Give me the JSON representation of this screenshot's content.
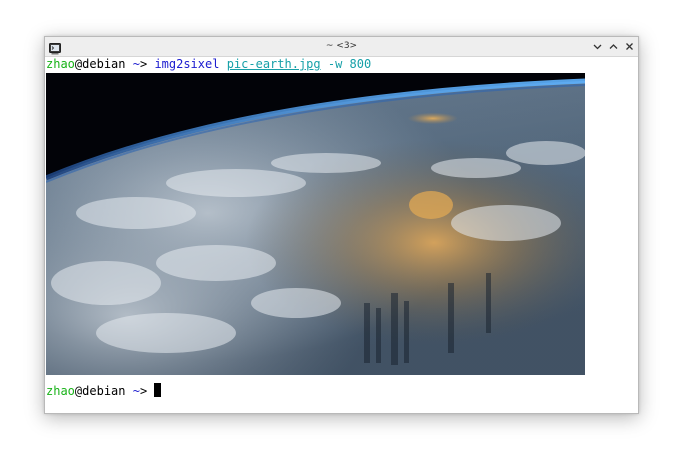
{
  "window": {
    "title": "~ <3>",
    "icon": "terminal-icon",
    "controls": [
      "chevron-down-icon",
      "chevron-up-icon",
      "close-icon"
    ]
  },
  "terminal": {
    "line1": {
      "user": "zhao",
      "at": "@",
      "host": "debian",
      "cwd": "~",
      "prompt_symbol": ">",
      "command": "img2sixel",
      "file_arg": "pic-earth.jpg",
      "option_arg": "-w 800"
    },
    "image": {
      "subject": "earth-from-orbit-image"
    },
    "line2": {
      "user": "zhao",
      "at": "@",
      "host": "debian",
      "cwd": "~",
      "prompt_symbol": ">"
    }
  },
  "colors": {
    "user": "#18b218",
    "command": "#1c1ccf",
    "argument": "#17a0a8",
    "text": "#000000"
  }
}
